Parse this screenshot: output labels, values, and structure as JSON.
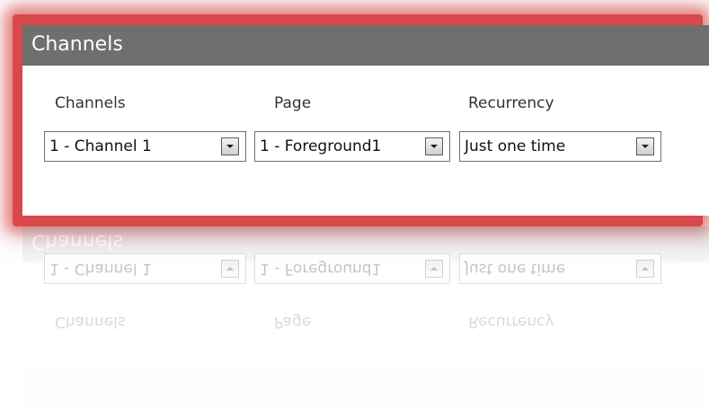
{
  "panel": {
    "title": "Channels",
    "fields": {
      "channels": {
        "label": "Channels",
        "value": "1 - Channel 1"
      },
      "page": {
        "label": "Page",
        "value": "1 - Foreground1"
      },
      "recurrency": {
        "label": "Recurrency",
        "value": "Just one time"
      }
    }
  },
  "colors": {
    "frame_glow": "#d9484a",
    "header_bg": "#6f6f6f",
    "header_text": "#ffffff"
  },
  "icons": {
    "dropdown": "chevron-down-icon"
  }
}
